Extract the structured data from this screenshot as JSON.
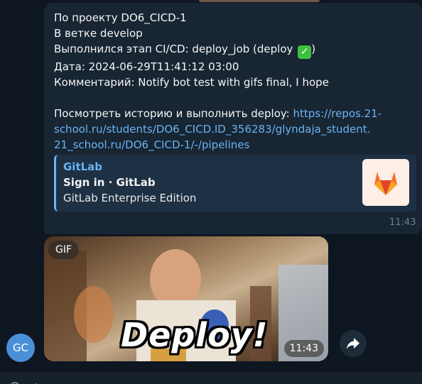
{
  "message": {
    "lines": [
      "По проекту DO6_CICD-1",
      "В ветке develop",
      "Выполнился этап CI/CD: deploy_job (deploy",
      ")",
      "Дата: 2024-06-29T11:41:12 03:00",
      "Комментарий: Notify bot test with gifs final, I hope"
    ],
    "history_prefix": "Посмотреть историю и выполнить deploy: ",
    "link_part1": "https://repos.21-",
    "link_part2": "school.ru/students/DO6_CICD.ID_356283/glyndaja_student.",
    "link_part3": "21_school.ru/DO6_CICD-1/-/pipelines",
    "check_glyph": "✓",
    "time": "11:43"
  },
  "preview": {
    "site": "GitLab",
    "title": "Sign in · GitLab",
    "description": "GitLab Enterprise Edition",
    "thumb_icon": "gitlab-logo-icon"
  },
  "gif": {
    "badge": "GIF",
    "caption": "Deploy!",
    "time": "11:43"
  },
  "avatar": {
    "initials": "GC",
    "color": "#4a90d9"
  },
  "forward": {
    "icon": "forward-arrow-icon"
  },
  "colors": {
    "background": "#0e1621",
    "bubble": "#182533",
    "link": "#6ab3f3",
    "timestamp": "#6d7f8f"
  }
}
